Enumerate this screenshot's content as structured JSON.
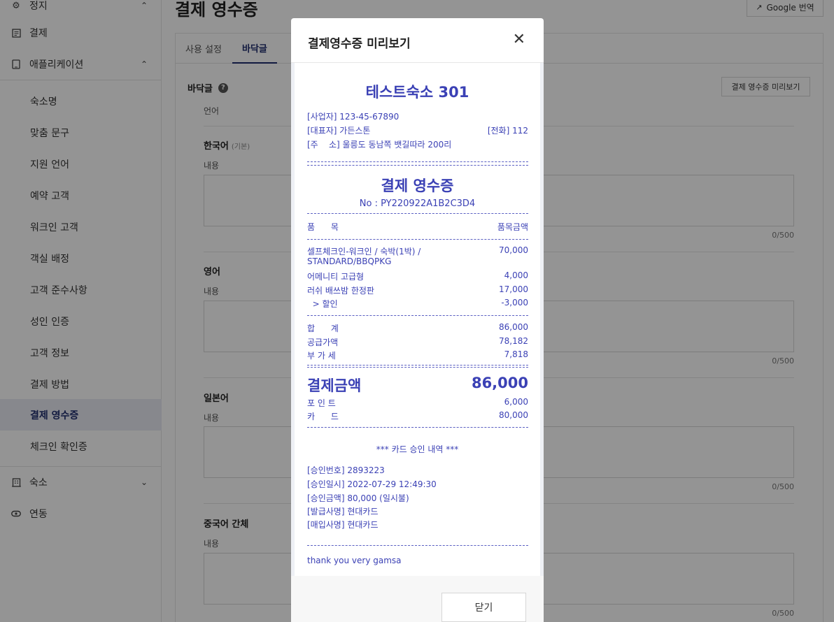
{
  "sidebar": {
    "top_items": [
      {
        "label": "정지",
        "icon": "gear-icon"
      },
      {
        "label": "결제",
        "icon": "receipt-icon"
      },
      {
        "label": "애플리케이션",
        "icon": "tablet-icon"
      }
    ],
    "sub_items": [
      {
        "label": "숙소명"
      },
      {
        "label": "맞춤 문구"
      },
      {
        "label": "지원 언어"
      },
      {
        "label": "예약 고객"
      },
      {
        "label": "워크인 고객"
      },
      {
        "label": "객실 배정"
      },
      {
        "label": "고객 준수사항"
      },
      {
        "label": "성인 인증"
      },
      {
        "label": "고객 정보"
      },
      {
        "label": "결제 방법"
      },
      {
        "label": "결제 영수증"
      },
      {
        "label": "체크인 확인증"
      }
    ],
    "bottom_items": [
      {
        "label": "숙소",
        "icon": "building-icon"
      },
      {
        "label": "연동",
        "icon": "link-icon"
      }
    ]
  },
  "header": {
    "title": "결제 영수증",
    "translate_label": "Google 번역"
  },
  "tabs": [
    {
      "label": "사용 설정"
    },
    {
      "label": "바닥글"
    }
  ],
  "section": {
    "title": "바닥글",
    "preview_button": "결제 영수증 미리보기",
    "language_label": "언어",
    "content_label": "내용",
    "counter": "0/500",
    "languages": [
      {
        "name": "한국어",
        "tag": "(기본)"
      },
      {
        "name": "영어",
        "tag": ""
      },
      {
        "name": "일본어",
        "tag": ""
      },
      {
        "name": "중국어 간체",
        "tag": ""
      }
    ]
  },
  "modal": {
    "title": "결제영수증 미리보기",
    "close_button": "닫기"
  },
  "receipt": {
    "shop_name": "테스트숙소 301",
    "business_no": "[사업자] 123-45-67890",
    "representative": "[대표자] 가든스톤",
    "phone": "[전화] 112",
    "address": "[주    소] 울릉도 동남쪽 뱃길따라 200리",
    "heading": "결제 영수증",
    "receipt_no": "No : PY220922A1B2C3D4",
    "col_item": "품      목",
    "col_amount": "품목금액",
    "items": [
      {
        "name": "셀프체크인-워크인 / 숙박(1박) /",
        "amount": "70,000"
      },
      {
        "name": "STANDARD/BBQPKG",
        "amount": ""
      },
      {
        "name": "어메니티 고급형",
        "amount": "4,000"
      },
      {
        "name": "러쉬 배쓰밤 한정판",
        "amount": "17,000"
      },
      {
        "name": "  > 할인",
        "amount": "-3,000"
      }
    ],
    "totals": [
      {
        "label": "합      계",
        "amount": "86,000"
      },
      {
        "label": "공급가액",
        "amount": "78,182"
      },
      {
        "label": "부 가 세",
        "amount": "7,818"
      }
    ],
    "pay_label": "결제금액",
    "pay_amount": "86,000",
    "methods": [
      {
        "label": "포 인 트",
        "amount": "6,000"
      },
      {
        "label": "카      드",
        "amount": "80,000"
      }
    ],
    "card_heading": "*** 카드 승인 내역 ***",
    "card_lines": [
      "[승인번호] 2893223",
      "[승인일시] 2022-07-29 12:49:30",
      "[승인금액] 80,000 (일시불)",
      "[발급사명] 현대카드",
      "[매입사명] 현대카드"
    ],
    "footer_text": "thank you very gamsa"
  },
  "colors": {
    "accent": "#1f2d6e",
    "receipt_text": "#3b41b5"
  }
}
